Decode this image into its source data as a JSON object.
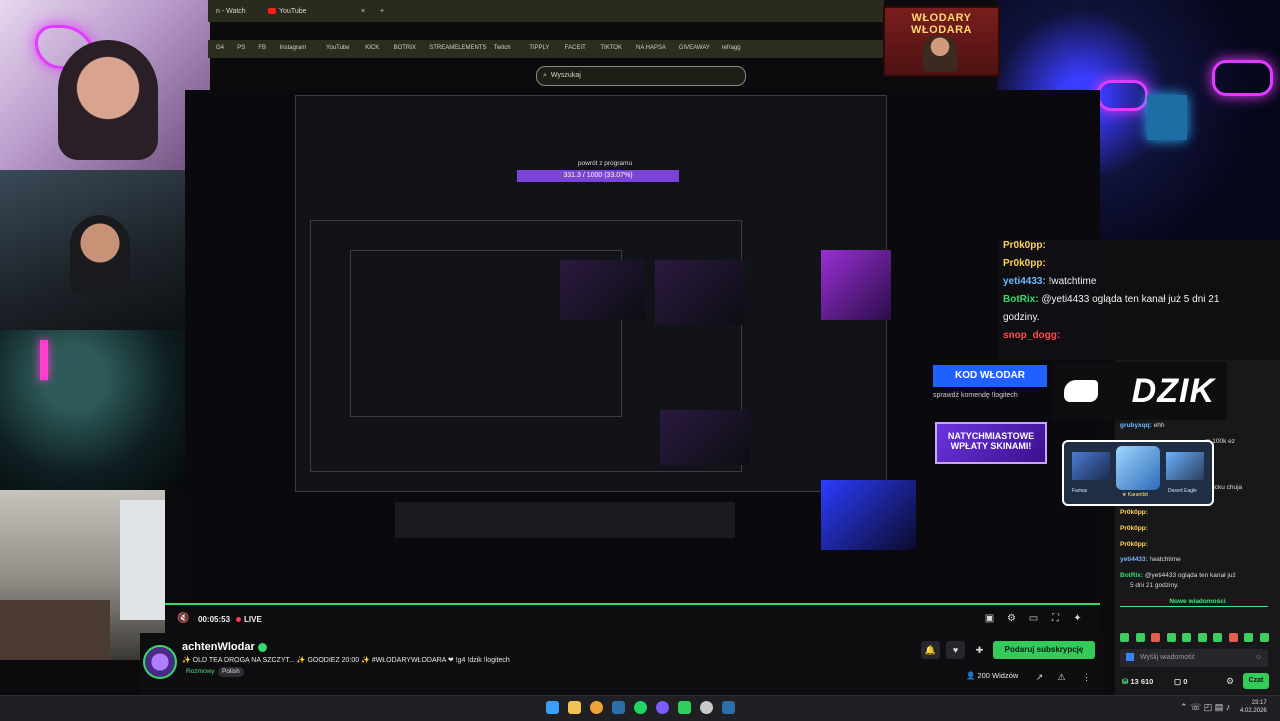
{
  "browser": {
    "tabs": [
      {
        "label": "n - Watch"
      },
      {
        "label": "YouTube"
      }
    ],
    "tab_close": "×",
    "new_tab": "+",
    "bookmarks": [
      "G4",
      "PS",
      "FB",
      "Instagram",
      "YouTube",
      "KICK",
      "BOTRIX",
      "STREAMELEMENTS",
      "Twitch",
      "TIPPLY",
      "FACEIT",
      "TIKTOK",
      "NA HAPSA",
      "GIVEAWAY",
      "refragg"
    ],
    "search_placeholder": "Wyszukaj",
    "promo_title": "WŁODARY WŁODARA"
  },
  "nested": {
    "powrot_label": "powrót z programu",
    "powrot_value": "331.3 / 1000 (33.07%)"
  },
  "overlay": {
    "kod": "KOD WŁODAR",
    "kod_sub": "sprawdź komendę !logitech",
    "wplaty": "NATYCHMIASTOWE WPŁATY SKINAMI!",
    "dzik": "DZIK",
    "card_left": "Famas",
    "card_mid": "★ Karambit",
    "card_right": "Desert Eagle"
  },
  "overlay_chat": [
    {
      "user": "Pr0k0pp:",
      "msg": "",
      "color": "#ffd25a"
    },
    {
      "user": "Pr0k0pp:",
      "msg": "",
      "color": "#ffd25a"
    },
    {
      "user": "yeti4433:",
      "msg": " !watchtime",
      "color": "#6fb8ff"
    },
    {
      "user": "BotRix:",
      "msg": " @yeti4433 ogląda ten kanał już 5 dni 21",
      "color": "#3bd96b"
    },
    {
      "user": "",
      "msg": "godziny.",
      "color": "#ffffff"
    },
    {
      "user": "snop_dogg:",
      "msg": "",
      "color": "#ff4a4a"
    }
  ],
  "side_chat": [
    {
      "user": "grubyxqq:",
      "msg": " ehh",
      "color": "#6fb8ff"
    },
    {
      "user": "",
      "msg": "m 100k ez",
      "color": "#ffffff"
    },
    {
      "user": "",
      "msg": "kicku chuja",
      "color": "#ffffff"
    },
    {
      "user": "Pr0k0pp:",
      "msg": "",
      "color": "#ffd25a"
    },
    {
      "user": "Pr0k0pp:",
      "msg": "",
      "color": "#ffd25a"
    },
    {
      "user": "Pr0k0pp:",
      "msg": "",
      "color": "#ffd25a"
    },
    {
      "user": "yeti4433:",
      "msg": " !watchtime",
      "color": "#6fb8ff"
    },
    {
      "user": "BotRix:",
      "msg": " @yeti4433 ogląda ten kanał już",
      "color": "#3bd96b"
    },
    {
      "user": "",
      "msg": "5 dni 21 godziny.",
      "color": "#ffffff"
    }
  ],
  "player": {
    "time": "00:05:53",
    "live": "LIVE"
  },
  "channel": {
    "name": "achtenWlodar",
    "title": "✨ OLD TEA DROGA NA SZCZYT... ✨ GOODIEZ 20:00 ✨ #WŁODARYWŁODARA ❤ !g4 !dzik !logitech",
    "category": "Rozmowy",
    "language": "Polish",
    "subscribe": "Podaruj subskrypcję",
    "viewers": "200",
    "viewers_label": "Widzów"
  },
  "chat_panel": {
    "new_messages": "Nowe wiadomości",
    "input_placeholder": "Wyślij wiadomość",
    "points": "13 610",
    "zero": "0",
    "send": "Czat"
  },
  "taskbar": {
    "time": "23:17",
    "date": "4.02.2026"
  },
  "colors": {
    "accent_green": "#33cc5a",
    "neon_pink": "#e23bff"
  }
}
